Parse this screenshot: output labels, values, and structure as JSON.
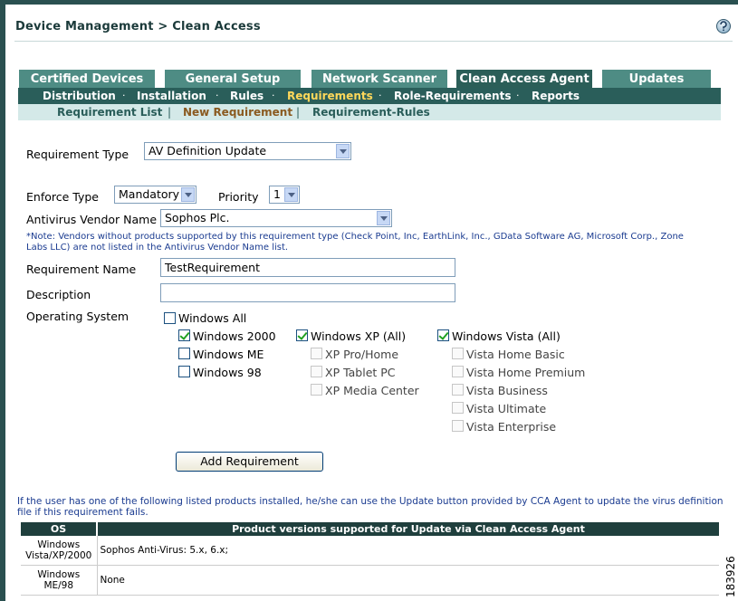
{
  "header": {
    "title": "Device Management > Clean Access"
  },
  "tabs": [
    {
      "label": "Certified Devices"
    },
    {
      "label": "General Setup"
    },
    {
      "label": "Network Scanner"
    },
    {
      "label": "Clean Access Agent"
    },
    {
      "label": "Updates"
    }
  ],
  "subnav": [
    {
      "label": "Distribution"
    },
    {
      "label": "Installation"
    },
    {
      "label": "Rules"
    },
    {
      "label": "Requirements"
    },
    {
      "label": "Role-Requirements"
    },
    {
      "label": "Reports"
    }
  ],
  "subnav2": [
    {
      "label": "Requirement List"
    },
    {
      "label": "New Requirement"
    },
    {
      "label": "Requirement-Rules"
    }
  ],
  "subnav2_separator": "|",
  "form": {
    "requirement_type_label": "Requirement Type",
    "requirement_type_value": "AV Definition Update",
    "enforce_type_label": "Enforce Type",
    "enforce_type_value": "Mandatory",
    "priority_label": "Priority",
    "priority_value": "1",
    "vendor_label": "Antivirus Vendor Name",
    "vendor_value": "Sophos Plc.",
    "note": "*Note: Vendors without products supported by this requirement type (Check Point, Inc, EarthLink, Inc., GData Software AG, Microsoft Corp., Zone Labs LLC) are not listed in the Antivirus Vendor Name list.",
    "name_label": "Requirement Name",
    "name_value": "TestRequirement",
    "description_label": "Description",
    "description_value": "",
    "os_label": "Operating System",
    "os_all": "Windows All",
    "os_win2000": "Windows 2000",
    "os_winme": "Windows ME",
    "os_win98": "Windows 98",
    "os_xp_all": "Windows XP (All)",
    "os_xp_pro": "XP Pro/Home",
    "os_xp_tablet": "XP Tablet PC",
    "os_xp_media": "XP Media Center",
    "os_vista_all": "Windows Vista (All)",
    "os_vista_basic": "Vista Home Basic",
    "os_vista_premium": "Vista Home Premium",
    "os_vista_business": "Vista Business",
    "os_vista_ultimate": "Vista Ultimate",
    "os_vista_enterprise": "Vista Enterprise",
    "add_button": "Add Requirement"
  },
  "info_text": "If the user has one of the following listed products installed, he/she can use the Update button provided by CCA Agent to update the virus definition file if this requirement fails.",
  "product_table": {
    "headers": [
      "OS",
      "Product versions supported for Update via Clean Access Agent"
    ],
    "rows": [
      {
        "os": "Windows Vista/XP/2000",
        "products": "Sophos Anti-Virus: 5.x, 6.x;"
      },
      {
        "os": "Windows ME/98",
        "products": "None"
      }
    ]
  },
  "figure_id": "183926",
  "colors": {
    "nav_dark": "#2a5e5a",
    "tab": "#4e8c84",
    "active_nav": "#ffd85a",
    "note_blue": "#1a3b90"
  }
}
